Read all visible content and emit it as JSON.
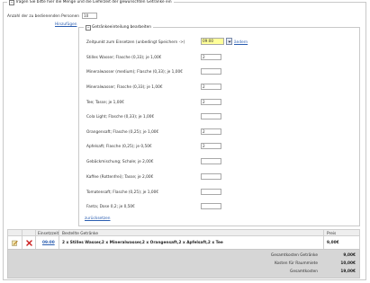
{
  "main_section": {
    "legend": "Tragen Sie bitte hier die Menge und die Lieferzeit der gewünschten Getränke ein"
  },
  "persons": {
    "label": "Anzahl der zu bedienenden Personen",
    "value": "10"
  },
  "add_link": "Hinzufügen",
  "edit_section": {
    "legend": "Getränkeeinteilung bearbeiten",
    "time_label": "Zeitpunkt zum Einsetzen (unbedingt Speichern ->)",
    "time_value": "09:00",
    "change_link": "ändern",
    "items": [
      {
        "label": "Stilles Wasser; Flasche (0,33); je 1,00€",
        "value": "2"
      },
      {
        "label": "Mineralwasser (medium); Flasche (0,33); je 1,00€",
        "value": ""
      },
      {
        "label": "Mineralwasser; Flasche (0,33); je 1,00€",
        "value": "2"
      },
      {
        "label": "Tee; Tasse; je 1,00€",
        "value": "2"
      },
      {
        "label": "Cola Light; Flasche (0,33); je 1,00€",
        "value": ""
      },
      {
        "label": "Orangensaft; Flasche (0,25); je 1,00€",
        "value": "2"
      },
      {
        "label": "Apfelsaft; Flasche (0,25); je 0,50€",
        "value": "2"
      },
      {
        "label": "Gebäckmischung; Schale; je 2,00€",
        "value": ""
      },
      {
        "label": "Kaffee (Rottenfrei); Tasse; je 2,00€",
        "value": ""
      },
      {
        "label": "Tomatensaft; Flasche (0,25); je 1,00€",
        "value": ""
      },
      {
        "label": "Fanta; Dose 0,2; je 0,50€",
        "value": ""
      }
    ],
    "back_link": "zurücksetzen"
  },
  "table": {
    "headers": {
      "time": "Einsetzzeit",
      "drinks": "Bestellte Getränke",
      "price": "Preis"
    },
    "row": {
      "time": "09:00",
      "drinks": "2 x Stilles Wasser,2 x Mineralwasser,2 x Orangensaft,2 x Apfelsaft,2 x Tee",
      "price": "9,00€"
    },
    "totals": [
      {
        "label": "Gesamtkosten Getränke",
        "value": "9,00€"
      },
      {
        "label": "Kosten für Raummiete",
        "value": "10,00€"
      },
      {
        "label": "Gesamtkosten",
        "value": "19,00€"
      }
    ]
  },
  "colors": {
    "time_highlight": "#ffff99",
    "link": "#2a5db0",
    "delete_icon": "#cc2222"
  }
}
